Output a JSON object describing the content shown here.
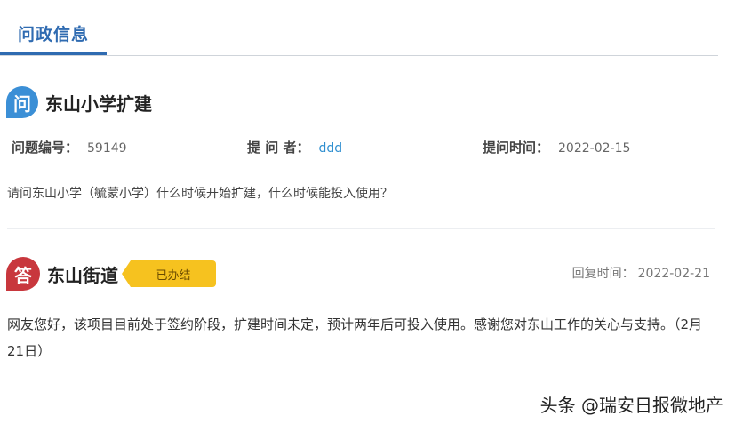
{
  "tab": {
    "label": "问政信息"
  },
  "question": {
    "badge": "问",
    "title": "东山小学扩建",
    "meta": {
      "id_label": "问题编号：",
      "id_value": "59149",
      "asker_label": "提 问 者：",
      "asker_value": "ddd",
      "time_label": "提问时间：",
      "time_value": "2022-02-15"
    },
    "body": "请问东山小学（毓蒙小学）什么时候开始扩建，什么时候能投入使用？"
  },
  "answer": {
    "badge": "答",
    "responder": "东山街道",
    "status": "已办结",
    "reply_time_label": "回复时间：",
    "reply_time_value": "2022-02-21",
    "body": "网友您好，该项目目前处于签约阶段，扩建时间未定，预计两年后可投入使用。感谢您对东山工作的关心与支持。（2月21日）"
  },
  "watermark": "头条 @瑞安日报微地产",
  "colors": {
    "tab_accent": "#2f6bb1",
    "question_badge": "#3b8fd6",
    "answer_badge": "#c8373d",
    "status_tag": "#f6c21f",
    "link": "#2f8fd0"
  }
}
